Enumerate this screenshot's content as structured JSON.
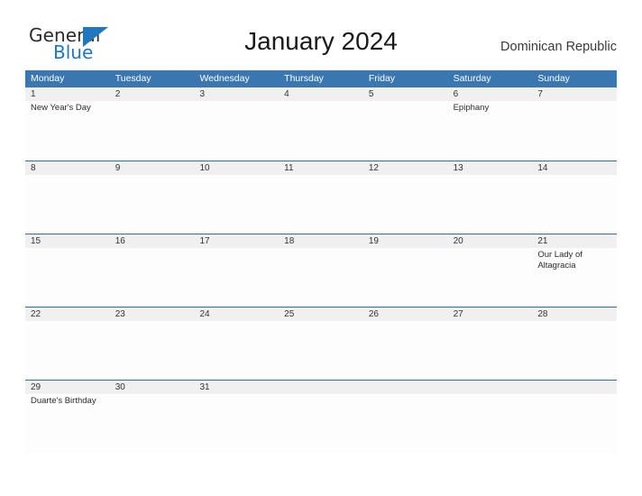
{
  "brand": {
    "logo_part1": "General",
    "logo_part2": "Blue",
    "logo_shape": "triangle-icon",
    "accent_color": "#1f77bf"
  },
  "header": {
    "title": "January 2024",
    "region": "Dominican Republic"
  },
  "colors": {
    "header_blue": "#3a76b0",
    "row_line_blue": "#2e6ca4",
    "date_band_gray": "#f0f0f0",
    "text_dark": "#333333"
  },
  "calendar": {
    "weekdays": [
      "Monday",
      "Tuesday",
      "Wednesday",
      "Thursday",
      "Friday",
      "Saturday",
      "Sunday"
    ],
    "weeks": [
      {
        "days": [
          {
            "num": "1",
            "event": "New Year's Day"
          },
          {
            "num": "2",
            "event": ""
          },
          {
            "num": "3",
            "event": ""
          },
          {
            "num": "4",
            "event": ""
          },
          {
            "num": "5",
            "event": ""
          },
          {
            "num": "6",
            "event": "Epiphany"
          },
          {
            "num": "7",
            "event": ""
          }
        ]
      },
      {
        "days": [
          {
            "num": "8",
            "event": ""
          },
          {
            "num": "9",
            "event": ""
          },
          {
            "num": "10",
            "event": ""
          },
          {
            "num": "11",
            "event": ""
          },
          {
            "num": "12",
            "event": ""
          },
          {
            "num": "13",
            "event": ""
          },
          {
            "num": "14",
            "event": ""
          }
        ]
      },
      {
        "days": [
          {
            "num": "15",
            "event": ""
          },
          {
            "num": "16",
            "event": ""
          },
          {
            "num": "17",
            "event": ""
          },
          {
            "num": "18",
            "event": ""
          },
          {
            "num": "19",
            "event": ""
          },
          {
            "num": "20",
            "event": ""
          },
          {
            "num": "21",
            "event": "Our Lady of Altagracia"
          }
        ]
      },
      {
        "days": [
          {
            "num": "22",
            "event": ""
          },
          {
            "num": "23",
            "event": ""
          },
          {
            "num": "24",
            "event": ""
          },
          {
            "num": "25",
            "event": ""
          },
          {
            "num": "26",
            "event": ""
          },
          {
            "num": "27",
            "event": ""
          },
          {
            "num": "28",
            "event": ""
          }
        ]
      },
      {
        "days": [
          {
            "num": "29",
            "event": "Duarte's Birthday"
          },
          {
            "num": "30",
            "event": ""
          },
          {
            "num": "31",
            "event": ""
          },
          {
            "num": "",
            "event": ""
          },
          {
            "num": "",
            "event": ""
          },
          {
            "num": "",
            "event": ""
          },
          {
            "num": "",
            "event": ""
          }
        ]
      }
    ]
  }
}
